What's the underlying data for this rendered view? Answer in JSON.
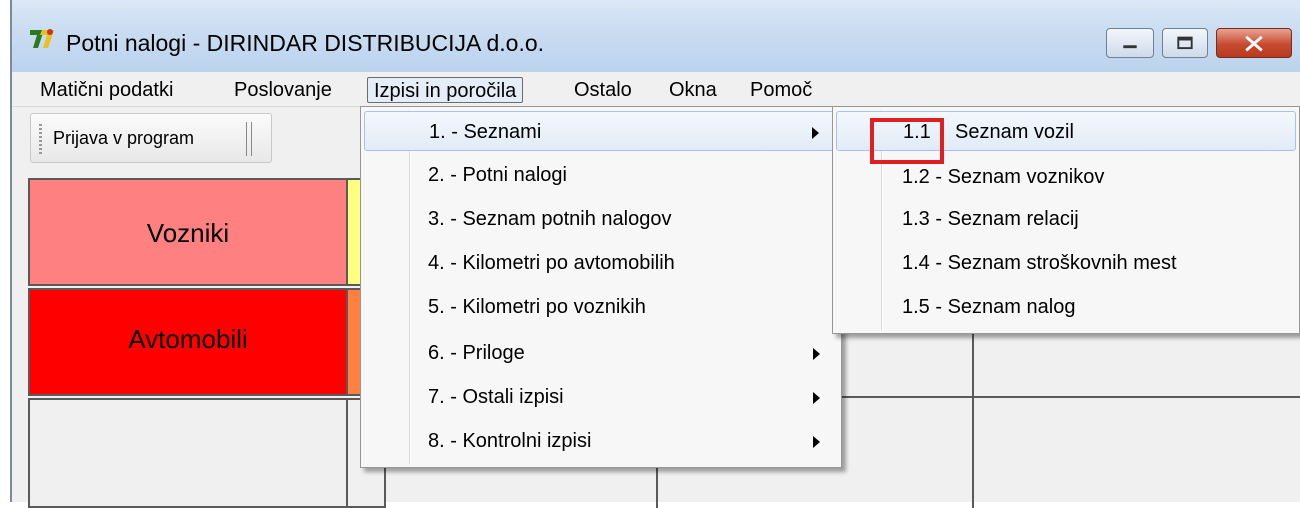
{
  "window": {
    "title": "Potni nalogi - DIRINDAR DISTRIBUCIJA d.o.o."
  },
  "menubar": {
    "items": [
      {
        "label": "Matični podatki"
      },
      {
        "label": "Poslovanje"
      },
      {
        "label": "Izpisi in poročila"
      },
      {
        "label": "Ostalo"
      },
      {
        "label": "Okna"
      },
      {
        "label": "Pomoč"
      }
    ]
  },
  "toolbar": {
    "login_label": "Prijava v program"
  },
  "tiles": {
    "drivers_label": "Vozniki",
    "cars_label": "Avtomobili",
    "drivers_color": "#ff8080",
    "cars_color": "#ff0000"
  },
  "dropdown": {
    "items": [
      {
        "label": "1. - Seznami",
        "submenu": true
      },
      {
        "label": "2. - Potni nalogi",
        "submenu": false
      },
      {
        "label": "3. - Seznam potnih nalogov",
        "submenu": false
      },
      {
        "label": "4. - Kilometri po avtomobilih",
        "submenu": false
      },
      {
        "label": "5. - Kilometri po voznikih",
        "submenu": false
      },
      {
        "label": "6. - Priloge",
        "submenu": true
      },
      {
        "label": "7. - Ostali izpisi",
        "submenu": true
      },
      {
        "label": "8. - Kontrolni izpisi",
        "submenu": true
      }
    ]
  },
  "submenu": {
    "first_num": "1.1",
    "first_rest": "Seznam vozil",
    "items": [
      {
        "label": "1.2 - Seznam voznikov"
      },
      {
        "label": "1.3 - Seznam relacij"
      },
      {
        "label": "1.4 - Seznam stroškovnih mest"
      },
      {
        "label": "1.5 - Seznam nalog"
      }
    ]
  }
}
